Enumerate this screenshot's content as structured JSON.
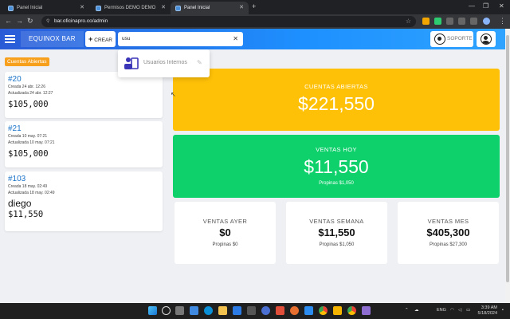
{
  "browser": {
    "tabs": [
      {
        "label": "Panel Inicial",
        "active": false
      },
      {
        "label": "Permisos DEMO DEMO",
        "active": false
      },
      {
        "label": "Panel Inicial",
        "active": true
      }
    ],
    "url": "bar.oficinapro.co/admin"
  },
  "header": {
    "brand": "EQUINOX BAR",
    "create_label": "CREAR",
    "search_value": "usu",
    "support_label": "SOPORTE"
  },
  "dropdown": {
    "item_label": "Usuarios Internos"
  },
  "open_accounts": {
    "badge": "Cuentas Abiertas",
    "items": [
      {
        "num": "#20",
        "created": "Creada 24 abr. 12:26",
        "updated": "Actualizada 24 abr. 12:27",
        "name": "",
        "amount": "$105,000"
      },
      {
        "num": "#21",
        "created": "Creada 10 may. 07:21",
        "updated": "Actualizada 10 may. 07:21",
        "name": "",
        "amount": "$105,000"
      },
      {
        "num": "#103",
        "created": "Creada 18 may. 02:49",
        "updated": "Actualizada 18 may. 02:49",
        "name": "diego",
        "amount": "$11,550"
      }
    ]
  },
  "stats": {
    "open": {
      "label": "CUENTAS ABIERTAS",
      "value": "$221,550"
    },
    "today": {
      "label": "VENTAS HOY",
      "value": "$11,550",
      "tips": "Propinas $1,050"
    },
    "yesterday": {
      "label": "VENTAS AYER",
      "value": "$0",
      "tips": "Propinas $0"
    },
    "week": {
      "label": "VENTAS SEMANA",
      "value": "$11,550",
      "tips": "Propinas $1,050"
    },
    "month": {
      "label": "VENTAS MES",
      "value": "$405,300",
      "tips": "Propinas $27,300"
    }
  },
  "colors": {
    "header_start": "#2a5bd7",
    "header_end": "#2fa3ff",
    "yellow_card": "#ffc107",
    "green_card": "#0fd16b",
    "badge": "#f7a01e",
    "account_link": "#1a73c9"
  },
  "taskbar": {
    "lang": "ENG",
    "time": "3:39 AM",
    "date": "5/18/2024"
  }
}
